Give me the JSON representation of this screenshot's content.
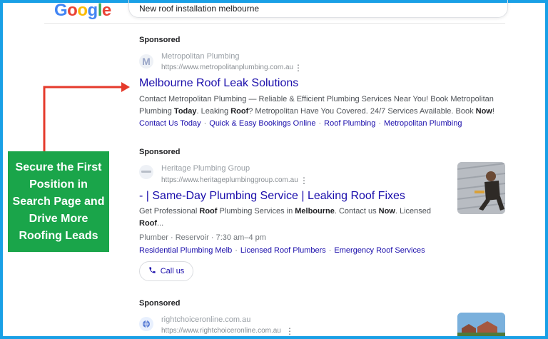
{
  "header": {
    "logo_letters": [
      {
        "ch": "G",
        "color": "#4285F4"
      },
      {
        "ch": "o",
        "color": "#EA4335"
      },
      {
        "ch": "o",
        "color": "#FBBC05"
      },
      {
        "ch": "g",
        "color": "#4285F4"
      },
      {
        "ch": "l",
        "color": "#34A853"
      },
      {
        "ch": "e",
        "color": "#EA4335"
      }
    ],
    "search_query": "New roof installation melbourne"
  },
  "ads": [
    {
      "sponsored": "Sponsored",
      "favicon_letter": "M",
      "advertiser": "Metropolitan Plumbing",
      "url": "https://www.metropolitanplumbing.com.au",
      "headline": "Melbourne Roof Leak Solutions",
      "desc_line1": "Contact Metropolitan Plumbing — Reliable & Efficient Plumbing Services Near You! Book Metropolitan",
      "desc_line2_parts": [
        {
          "t": "Plumbing ",
          "b": false
        },
        {
          "t": "Today",
          "b": true
        },
        {
          "t": ". Leaking ",
          "b": false
        },
        {
          "t": "Roof",
          "b": true
        },
        {
          "t": "? Metropolitan Have You Covered. 24/7 Services Available. Book ",
          "b": false
        },
        {
          "t": "Now",
          "b": true
        },
        {
          "t": "!",
          "b": false
        }
      ],
      "sitelinks": [
        "Contact Us Today",
        "Quick & Easy Bookings Online",
        "Roof Plumbing",
        "Metropolitan Plumbing"
      ]
    },
    {
      "sponsored": "Sponsored",
      "advertiser": "Heritage Plumbing Group",
      "url": "https://www.heritageplumbinggroup.com.au",
      "headline": "- | Same-Day Plumbing Service | Leaking Roof Fixes",
      "desc_line1_parts": [
        {
          "t": "Get Professional ",
          "b": false
        },
        {
          "t": "Roof",
          "b": true
        },
        {
          "t": " Plumbing Services in ",
          "b": false
        },
        {
          "t": "Melbourne",
          "b": true
        },
        {
          "t": ". Contact us ",
          "b": false
        },
        {
          "t": "Now",
          "b": true
        },
        {
          "t": ". Licensed",
          "b": false
        }
      ],
      "desc_line2_parts": [
        {
          "t": "Roof",
          "b": true
        },
        {
          "t": "...",
          "b": false
        }
      ],
      "meta": "Plumber · Reservoir · 7:30 am–4 pm",
      "sitelinks": [
        "Residential Plumbing Melb",
        "Licensed Roof Plumbers",
        "Emergency Roof Services"
      ],
      "call_label": "Call us"
    },
    {
      "sponsored": "Sponsored",
      "advertiser": "rightchoiceronline.com.au",
      "url": "https://www.rightchoiceronline.com.au"
    }
  ],
  "promo": {
    "text": "Secure the First Position in Search Page and Drive More Roofing Leads",
    "bg_color": "#1AA54A",
    "arrow_color": "#E53A2B"
  }
}
